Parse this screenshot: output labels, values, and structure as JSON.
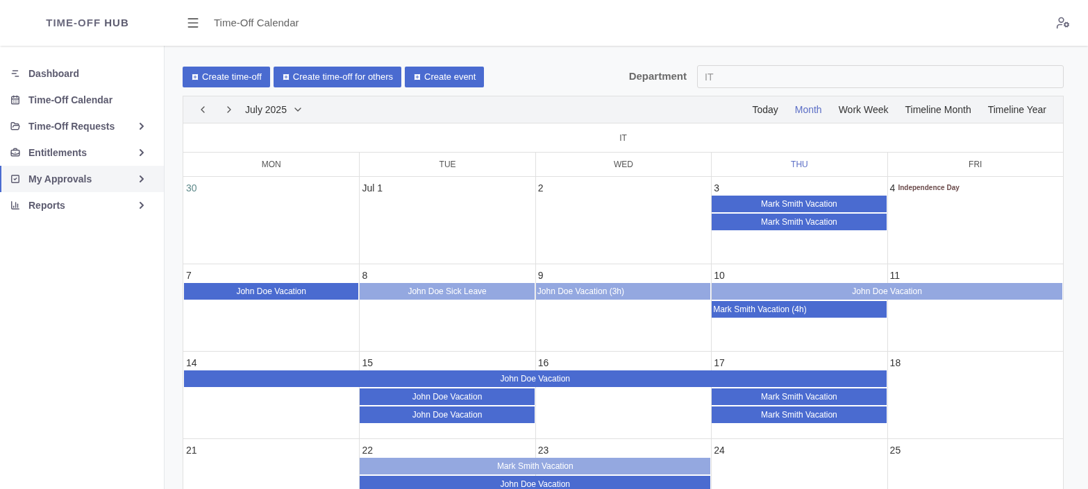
{
  "brand": {
    "light": "TIME-OFF ",
    "bold": "HUB"
  },
  "header": {
    "title": "Time-Off Calendar"
  },
  "sidebar": {
    "items": [
      {
        "label": "Dashboard",
        "has_children": false,
        "selected": false
      },
      {
        "label": "Time-Off Calendar",
        "has_children": false,
        "selected": false
      },
      {
        "label": "Time-Off Requests",
        "has_children": true,
        "selected": false
      },
      {
        "label": "Entitlements",
        "has_children": true,
        "selected": false
      },
      {
        "label": "My Approvals",
        "has_children": true,
        "selected": true
      },
      {
        "label": "Reports",
        "has_children": true,
        "selected": false
      }
    ]
  },
  "actions": [
    "Create time-off",
    "Create time-off for others",
    "Create event"
  ],
  "department": {
    "label": "Department",
    "placeholder": "IT"
  },
  "calendar": {
    "period": "July 2025",
    "views": [
      {
        "label": "Today",
        "selected": false
      },
      {
        "label": "Month",
        "selected": true
      },
      {
        "label": "Work Week",
        "selected": false
      },
      {
        "label": "Timeline Month",
        "selected": false
      },
      {
        "label": "Timeline Year",
        "selected": false
      }
    ],
    "group": "IT",
    "days": [
      {
        "label": "MON",
        "today": false
      },
      {
        "label": "TUE",
        "today": false
      },
      {
        "label": "WED",
        "today": false
      },
      {
        "label": "THU",
        "today": true
      },
      {
        "label": "FRI",
        "today": false
      }
    ],
    "weeks": [
      {
        "dates": [
          {
            "label": "30",
            "other_month": true
          },
          {
            "label": "Jul 1",
            "other_month": false
          },
          {
            "label": "2",
            "other_month": false
          },
          {
            "label": "3",
            "other_month": false
          },
          {
            "label": "4",
            "other_month": false,
            "holiday": "Independence Day"
          }
        ],
        "lanes": [
          [
            {
              "kind": "empty"
            },
            {
              "kind": "empty"
            },
            {
              "kind": "empty"
            },
            {
              "kind": "event",
              "title": "Mark Smith Vacation",
              "pending": false,
              "partial": false
            },
            {
              "kind": "empty"
            }
          ],
          [
            {
              "kind": "empty"
            },
            {
              "kind": "empty"
            },
            {
              "kind": "empty"
            },
            {
              "kind": "event",
              "title": "Mark Smith Vacation",
              "pending": false,
              "partial": false
            },
            {
              "kind": "empty"
            }
          ]
        ]
      },
      {
        "dates": [
          {
            "label": "7",
            "other_month": false
          },
          {
            "label": "8",
            "other_month": false
          },
          {
            "label": "9",
            "other_month": false
          },
          {
            "label": "10",
            "other_month": false
          },
          {
            "label": "11",
            "other_month": false
          }
        ],
        "lanes": [
          [
            {
              "kind": "event",
              "title": "John Doe Vacation",
              "pending": false,
              "partial": false
            },
            {
              "kind": "event",
              "title": "John Doe Sick Leave",
              "pending": true,
              "partial": false
            },
            {
              "kind": "event",
              "title": "John Doe Vacation (3h)",
              "pending": true,
              "partial": true
            },
            {
              "kind": "event",
              "title": "John Doe Vacation",
              "pending": true,
              "partial": false
            },
            {
              "kind": "continued"
            }
          ],
          [
            {
              "kind": "empty"
            },
            {
              "kind": "empty"
            },
            {
              "kind": "empty"
            },
            {
              "kind": "event",
              "title": "Mark Smith Vacation (4h)",
              "pending": false,
              "partial": true
            },
            {
              "kind": "empty"
            }
          ]
        ]
      },
      {
        "dates": [
          {
            "label": "14",
            "other_month": false
          },
          {
            "label": "15",
            "other_month": false
          },
          {
            "label": "16",
            "other_month": false
          },
          {
            "label": "17",
            "other_month": false
          },
          {
            "label": "18",
            "other_month": false
          }
        ],
        "lanes": [
          [
            {
              "kind": "event",
              "title": "John Doe Vacation",
              "pending": false,
              "partial": false
            },
            {
              "kind": "continued"
            },
            {
              "kind": "continued"
            },
            {
              "kind": "continued"
            },
            {
              "kind": "empty"
            }
          ],
          [
            {
              "kind": "empty"
            },
            {
              "kind": "event",
              "title": "John Doe Vacation",
              "pending": false,
              "partial": false
            },
            {
              "kind": "empty"
            },
            {
              "kind": "event",
              "title": "Mark Smith Vacation",
              "pending": false,
              "partial": false
            },
            {
              "kind": "empty"
            }
          ],
          [
            {
              "kind": "empty"
            },
            {
              "kind": "event",
              "title": "John Doe Vacation",
              "pending": false,
              "partial": false
            },
            {
              "kind": "empty"
            },
            {
              "kind": "event",
              "title": "Mark Smith Vacation",
              "pending": false,
              "partial": false
            },
            {
              "kind": "empty"
            }
          ]
        ]
      },
      {
        "dates": [
          {
            "label": "21",
            "other_month": false
          },
          {
            "label": "22",
            "other_month": false
          },
          {
            "label": "23",
            "other_month": false
          },
          {
            "label": "24",
            "other_month": false
          },
          {
            "label": "25",
            "other_month": false
          }
        ],
        "lanes": [
          [
            {
              "kind": "empty"
            },
            {
              "kind": "event",
              "title": "Mark Smith Vacation",
              "pending": true,
              "partial": false
            },
            {
              "kind": "continued"
            },
            {
              "kind": "empty"
            },
            {
              "kind": "empty"
            }
          ],
          [
            {
              "kind": "empty"
            },
            {
              "kind": "event",
              "title": "John Doe Vacation",
              "pending": false,
              "partial": false
            },
            {
              "kind": "continued"
            },
            {
              "kind": "empty"
            },
            {
              "kind": "empty"
            }
          ]
        ]
      }
    ]
  }
}
